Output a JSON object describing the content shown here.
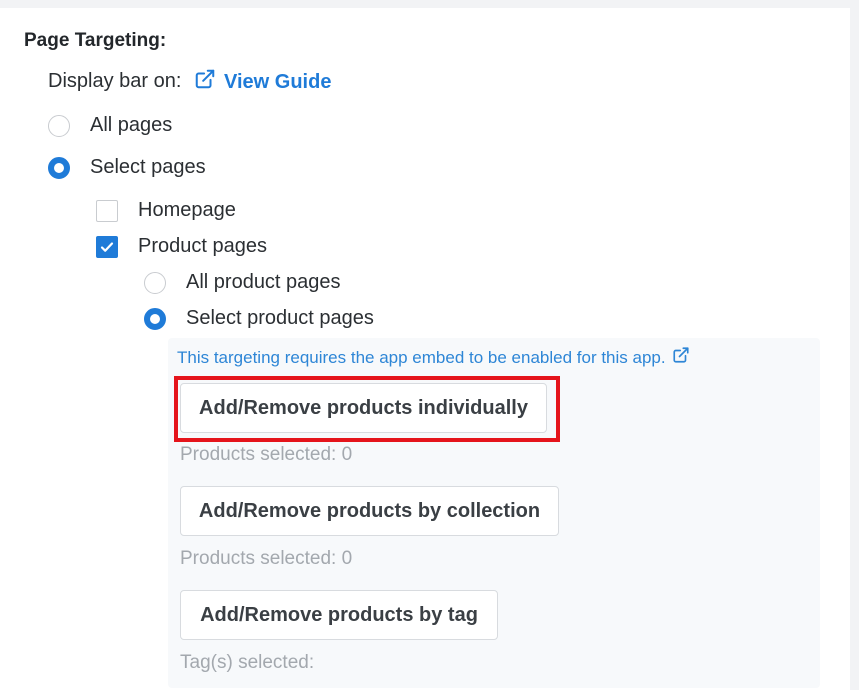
{
  "section": {
    "title": "Page Targeting:",
    "display_label": "Display bar on:",
    "guide_link": "View Guide"
  },
  "options": {
    "all_pages": "All pages",
    "select_pages": "Select pages",
    "homepage": "Homepage",
    "product_pages": "Product pages",
    "all_product_pages": "All product pages",
    "select_product_pages": "Select product pages"
  },
  "state": {
    "page_scope": "Select pages",
    "homepage_checked": false,
    "product_pages_checked": true,
    "product_scope": "Select product pages"
  },
  "panel": {
    "note": "This targeting requires the app embed to be enabled for this app.",
    "individually_button": "Add/Remove products individually",
    "individually_count": "Products selected: 0",
    "collection_button": "Add/Remove products by collection",
    "collection_count": "Products selected: 0",
    "tag_button": "Add/Remove products by tag",
    "tag_count": "Tag(s) selected:"
  },
  "colors": {
    "accent": "#1f7bd8",
    "highlight": "#e5141b",
    "hint": "#a3a8ae"
  },
  "icons": {
    "guide": "external-link-icon",
    "note": "external-link-icon",
    "check": "checkmark-icon"
  }
}
